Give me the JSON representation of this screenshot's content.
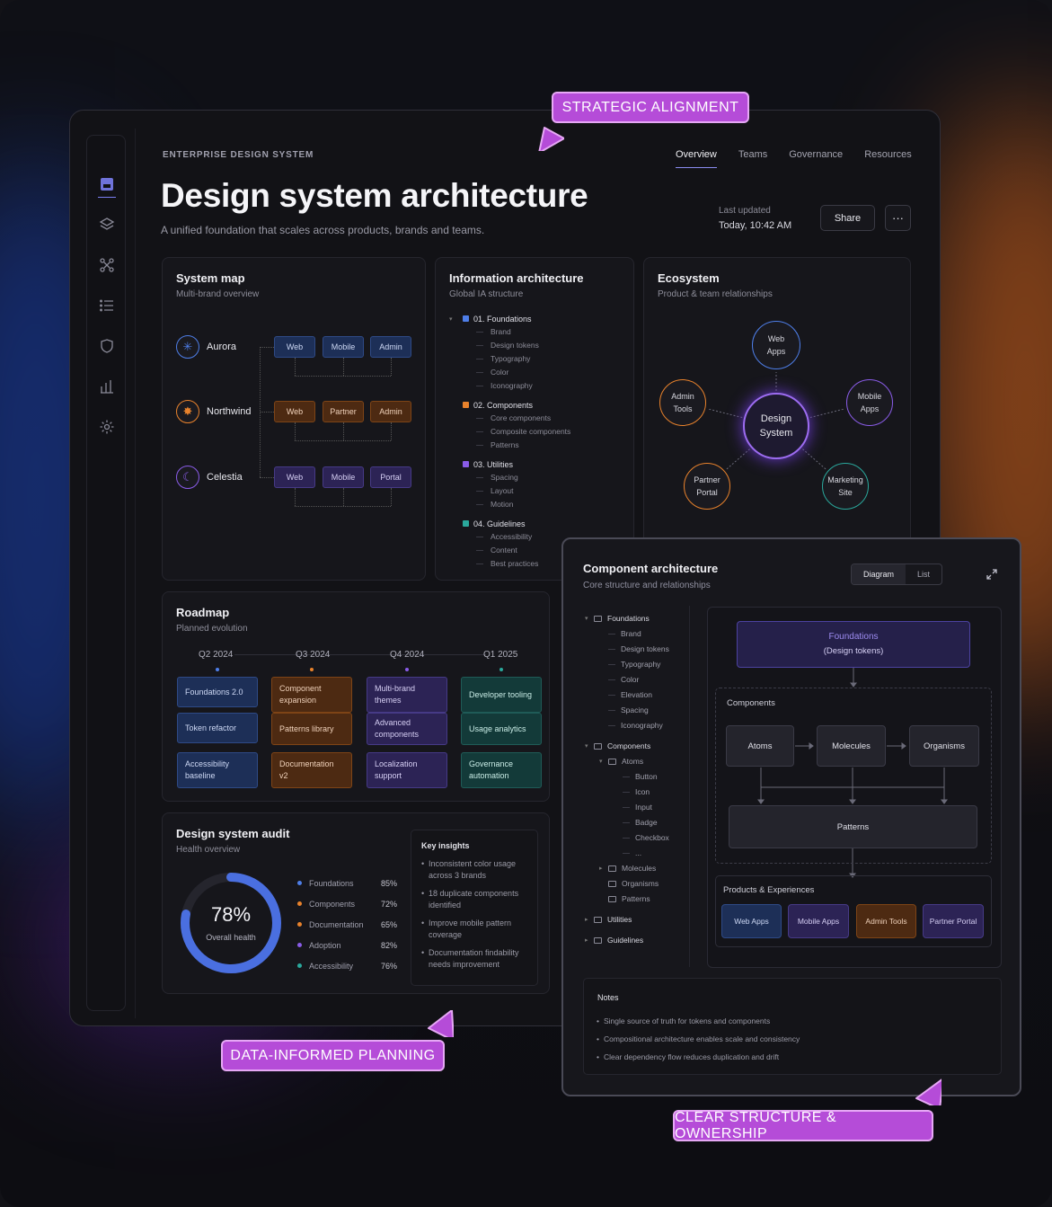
{
  "callouts": {
    "strategic": "STRATEGIC ALIGNMENT",
    "data": "DATA-INFORMED PLANNING",
    "structure": "CLEAR STRUCTURE & OWNERSHIP"
  },
  "header": {
    "kicker": "ENTERPRISE DESIGN SYSTEM",
    "title": "Design system architecture",
    "subtitle": "A unified foundation that scales across products, brands and teams.",
    "tabs": [
      "Overview",
      "Teams",
      "Governance",
      "Resources"
    ],
    "last_updated_label": "Last updated",
    "last_updated_value": "Today, 10:42 AM",
    "share": "Share",
    "more": "···"
  },
  "system_map": {
    "title": "System map",
    "subtitle": "Multi-brand overview",
    "brands": [
      {
        "name": "Aurora",
        "icon": "asterisk-icon",
        "chips": [
          "Web",
          "Mobile",
          "Admin"
        ],
        "color": "#4e7ee8"
      },
      {
        "name": "Northwind",
        "icon": "star-burst-icon",
        "chips": [
          "Web",
          "Partner",
          "Admin"
        ],
        "color": "#e8822c"
      },
      {
        "name": "Celestia",
        "icon": "moon-icon",
        "chips": [
          "Web",
          "Mobile",
          "Portal"
        ],
        "color": "#8a5ce8"
      }
    ]
  },
  "info_arch": {
    "title": "Information architecture",
    "subtitle": "Global IA structure",
    "sections": [
      {
        "label": "01.  Foundations",
        "color": "#4e7ee8",
        "items": [
          "Brand",
          "Design tokens",
          "Typography",
          "Color",
          "Iconography"
        ]
      },
      {
        "label": "02.  Components",
        "color": "#e8822c",
        "items": [
          "Core components",
          "Composite components",
          "Patterns"
        ]
      },
      {
        "label": "03.  Utilities",
        "color": "#8a5ce8",
        "items": [
          "Spacing",
          "Layout",
          "Motion"
        ]
      },
      {
        "label": "04.  Guidelines",
        "color": "#2aa89c",
        "items": [
          "Accessibility",
          "Content",
          "Best practices"
        ]
      }
    ]
  },
  "ecosystem": {
    "title": "Ecosystem",
    "subtitle": "Product & team relationships",
    "center": [
      "Design",
      "System"
    ],
    "nodes": [
      {
        "lines": [
          "Web",
          "Apps"
        ],
        "color": "#4e7ee8"
      },
      {
        "lines": [
          "Mobile",
          "Apps"
        ],
        "color": "#8a5ce8"
      },
      {
        "lines": [
          "Marketing",
          "Site"
        ],
        "color": "#2aa89c"
      },
      {
        "lines": [
          "Partner",
          "Portal"
        ],
        "color": "#e8822c"
      },
      {
        "lines": [
          "Admin",
          "Tools"
        ],
        "color": "#e8822c"
      }
    ]
  },
  "roadmap": {
    "title": "Roadmap",
    "subtitle": "Planned evolution",
    "quarters": [
      "Q2 2024",
      "Q3 2024",
      "Q4 2024",
      "Q1 2025"
    ],
    "columns": [
      {
        "style": "c-blue",
        "items": [
          "Foundations 2.0",
          "Token refactor",
          "Accessibility baseline"
        ]
      },
      {
        "style": "c-orange",
        "items": [
          "Component expansion",
          "Patterns library",
          "Documentation v2"
        ]
      },
      {
        "style": "c-purple",
        "items": [
          "Multi-brand themes",
          "Advanced components",
          "Localization support"
        ]
      },
      {
        "style": "c-teal",
        "items": [
          "Developer tooling",
          "Usage analytics",
          "Governance automation"
        ]
      }
    ]
  },
  "audit": {
    "title": "Design system audit",
    "subtitle": "Health overview",
    "overall": "78%",
    "overall_label": "Overall health",
    "overall_value": 0.78,
    "metrics": [
      {
        "label": "Foundations",
        "value": "85%",
        "color": "#4e7ee8"
      },
      {
        "label": "Components",
        "value": "72%",
        "color": "#e8822c"
      },
      {
        "label": "Documentation",
        "value": "65%",
        "color": "#e8822c"
      },
      {
        "label": "Adoption",
        "value": "82%",
        "color": "#8a5ce8"
      },
      {
        "label": "Accessibility",
        "value": "76%",
        "color": "#2aa89c"
      }
    ],
    "insights_title": "Key insights",
    "insights": [
      "Inconsistent color usage across 3 brands",
      "18 duplicate components identified",
      "Improve mobile pattern coverage",
      "Documentation findability needs improvement"
    ]
  },
  "component_arch": {
    "title": "Component architecture",
    "subtitle": "Core structure and relationships",
    "view_toggle": [
      "Diagram",
      "List"
    ],
    "tree": [
      {
        "depth": 0,
        "caret": "▾",
        "label": "Foundations",
        "folder": true
      },
      {
        "depth": 1,
        "label": "Brand"
      },
      {
        "depth": 1,
        "label": "Design tokens"
      },
      {
        "depth": 1,
        "label": "Typography"
      },
      {
        "depth": 1,
        "label": "Color"
      },
      {
        "depth": 1,
        "label": "Elevation"
      },
      {
        "depth": 1,
        "label": "Spacing"
      },
      {
        "depth": 1,
        "label": "Iconography"
      },
      {
        "depth": 0,
        "caret": "▾",
        "label": "Components",
        "folder": true
      },
      {
        "depth": 1,
        "caret": "▾",
        "label": "Atoms",
        "folder": true
      },
      {
        "depth": 2,
        "label": "Button"
      },
      {
        "depth": 2,
        "label": "Icon"
      },
      {
        "depth": 2,
        "label": "Input"
      },
      {
        "depth": 2,
        "label": "Badge"
      },
      {
        "depth": 2,
        "label": "Checkbox"
      },
      {
        "depth": 2,
        "label": "..."
      },
      {
        "depth": 1,
        "caret": "▸",
        "label": "Molecules",
        "folder": true
      },
      {
        "depth": 1,
        "label": "Organisms",
        "folder": true
      },
      {
        "depth": 1,
        "label": "Patterns",
        "folder": true
      },
      {
        "depth": 0,
        "caret": "▸",
        "label": "Utilities",
        "folder": true
      },
      {
        "depth": 0,
        "caret": "▸",
        "label": "Guidelines",
        "folder": true
      }
    ],
    "diagram": {
      "foundations": [
        "Foundations",
        "(Design tokens)"
      ],
      "components_label": "Components",
      "atoms": "Atoms",
      "molecules": "Molecules",
      "organisms": "Organisms",
      "patterns": "Patterns",
      "products_label": "Products & Experiences",
      "products": [
        {
          "label": "Web Apps",
          "style": "c-blue"
        },
        {
          "label": "Mobile Apps",
          "style": "c-purple"
        },
        {
          "label": "Admin Tools",
          "style": "c-orange"
        },
        {
          "label": "Partner Portal",
          "style": "c-purple"
        }
      ]
    },
    "notes_title": "Notes",
    "notes": [
      "Single source of truth for tokens and components",
      "Compositional architecture enables scale and consistency",
      "Clear dependency flow reduces duplication and drift"
    ]
  }
}
